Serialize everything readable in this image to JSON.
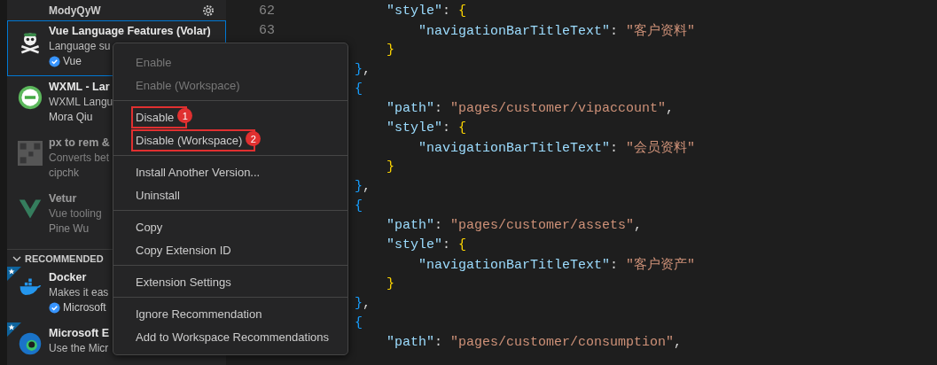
{
  "sidebar": {
    "installed": [
      {
        "kind": "partial",
        "publisher": "ModyQyW",
        "gear": true
      },
      {
        "kind": "extension",
        "name": "Vue Language Features (Volar)",
        "description": "Language su",
        "publisher": "Vue",
        "verified": true,
        "dimmed": false,
        "selected": true
      },
      {
        "kind": "extension",
        "name": "WXML - Lar",
        "description": "WXML Langu",
        "publisher": "Mora Qiu",
        "verified": false,
        "dimmed": false,
        "selected": false
      },
      {
        "kind": "extension",
        "name": "px to rem &",
        "description": "Converts bet",
        "publisher": "cipchk",
        "verified": false,
        "dimmed": true,
        "selected": false
      },
      {
        "kind": "extension",
        "name": "Vetur",
        "description": "Vue tooling",
        "publisher": "Pine Wu",
        "verified": false,
        "dimmed": true,
        "selected": false
      }
    ],
    "recommended": {
      "title": "RECOMMENDED",
      "expanded": true,
      "items": [
        {
          "kind": "extension",
          "name": "Docker",
          "description": "Makes it eas",
          "publisher": "Microsoft",
          "verified": true,
          "dimmed": false,
          "selected": false
        },
        {
          "kind": "extension",
          "name": "Microsoft E",
          "description": "Use the Micr",
          "dimmed": false,
          "selected": false
        }
      ]
    }
  },
  "editor": {
    "lines": [
      {
        "children": [
          {
            "number": "62",
            "tokens": [
              {
                "kind": "key",
                "text": "\"style\""
              },
              {
                "kind": "punct",
                "text": ": "
              },
              {
                "kind": "brace2",
                "text": "{"
              }
            ],
            "children": [
              {
                "number": "63",
                "tokens": [
                  {
                    "kind": "key",
                    "text": "\"navigationBarTitleText\""
                  },
                  {
                    "kind": "punct",
                    "text": ": "
                  },
                  {
                    "kind": "str",
                    "text": "\"客户资料\""
                  }
                ]
              }
            ]
          },
          {
            "tokens": [
              {
                "kind": "brace2",
                "text": "}"
              }
            ]
          }
        ]
      },
      {
        "tokens": [
          {
            "kind": "brace1",
            "text": "}"
          },
          {
            "kind": "punct",
            "text": ","
          }
        ]
      },
      {
        "tokens": [
          {
            "kind": "brace1",
            "text": "{"
          }
        ],
        "children": [
          {
            "tokens": [
              {
                "kind": "key",
                "text": "\"path\""
              },
              {
                "kind": "punct",
                "text": ": "
              },
              {
                "kind": "str",
                "text": "\"pages/customer/vipaccount\""
              },
              {
                "kind": "punct",
                "text": ","
              }
            ]
          },
          {
            "tokens": [
              {
                "kind": "key",
                "text": "\"style\""
              },
              {
                "kind": "punct",
                "text": ": "
              },
              {
                "kind": "brace2",
                "text": "{"
              }
            ],
            "children": [
              {
                "tokens": [
                  {
                    "kind": "key",
                    "text": "\"navigationBarTitleText\""
                  },
                  {
                    "kind": "punct",
                    "text": ": "
                  },
                  {
                    "kind": "str",
                    "text": "\"会员资料\""
                  }
                ]
              }
            ]
          },
          {
            "tokens": [
              {
                "kind": "brace2",
                "text": "}"
              }
            ]
          }
        ]
      },
      {
        "tokens": [
          {
            "kind": "brace1",
            "text": "}"
          },
          {
            "kind": "punct",
            "text": ","
          }
        ]
      },
      {
        "tokens": [
          {
            "kind": "brace1",
            "text": "{"
          }
        ],
        "children": [
          {
            "tokens": [
              {
                "kind": "key",
                "text": "\"path\""
              },
              {
                "kind": "punct",
                "text": ": "
              },
              {
                "kind": "str",
                "text": "\"pages/customer/assets\""
              },
              {
                "kind": "punct",
                "text": ","
              }
            ]
          },
          {
            "tokens": [
              {
                "kind": "key",
                "text": "\"style\""
              },
              {
                "kind": "punct",
                "text": ": "
              },
              {
                "kind": "brace2",
                "text": "{"
              }
            ],
            "children": [
              {
                "tokens": [
                  {
                    "kind": "key",
                    "text": "\"navigationBarTitleText\""
                  },
                  {
                    "kind": "punct",
                    "text": ": "
                  },
                  {
                    "kind": "str",
                    "text": "\"客户资产\""
                  }
                ]
              }
            ]
          },
          {
            "tokens": [
              {
                "kind": "brace2",
                "text": "}"
              }
            ]
          }
        ]
      },
      {
        "tokens": [
          {
            "kind": "brace1",
            "text": "}"
          },
          {
            "kind": "punct",
            "text": ","
          }
        ]
      },
      {
        "tokens": [
          {
            "kind": "brace1",
            "text": "{"
          }
        ],
        "children": [
          {
            "tokens": [
              {
                "kind": "key",
                "text": "\"path\""
              },
              {
                "kind": "punct",
                "text": ": "
              },
              {
                "kind": "str",
                "text": "\"pages/customer/consumption\""
              },
              {
                "kind": "punct",
                "text": ","
              }
            ]
          }
        ]
      }
    ]
  },
  "context_menu": {
    "items": [
      {
        "kind": "item",
        "label": "Enable",
        "disabled": true
      },
      {
        "kind": "item",
        "label": "Enable (Workspace)",
        "disabled": true
      },
      {
        "kind": "separator"
      },
      {
        "kind": "item",
        "label": "Disable",
        "disabled": false,
        "annotation": "1"
      },
      {
        "kind": "item",
        "label": "Disable (Workspace)",
        "disabled": false,
        "annotation": "2"
      },
      {
        "kind": "separator"
      },
      {
        "kind": "item",
        "label": "Install Another Version...",
        "disabled": false
      },
      {
        "kind": "item",
        "label": "Uninstall",
        "disabled": false
      },
      {
        "kind": "separator"
      },
      {
        "kind": "item",
        "label": "Copy",
        "disabled": false
      },
      {
        "kind": "item",
        "label": "Copy Extension ID",
        "disabled": false
      },
      {
        "kind": "separator"
      },
      {
        "kind": "item",
        "label": "Extension Settings",
        "disabled": false
      },
      {
        "kind": "separator"
      },
      {
        "kind": "item",
        "label": "Ignore Recommendation",
        "disabled": false
      },
      {
        "kind": "item",
        "label": "Add to Workspace Recommendations",
        "disabled": false
      }
    ]
  }
}
